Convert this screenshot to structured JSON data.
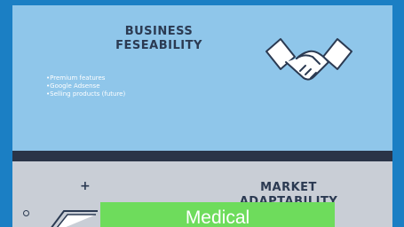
{
  "business": {
    "title_line1": "BUSINESS",
    "title_line2": "FESEABILITY",
    "bullets": [
      "Premium features",
      "Google Adsense",
      "Selling products (future)"
    ]
  },
  "market": {
    "title": "MARKET ADAPTABILITY"
  },
  "badge": {
    "label": "Medical"
  },
  "icons": {
    "handshake": "handshake-icon",
    "plus": "plus-icon",
    "circle": "circle-icon",
    "device": "device-icon"
  },
  "colors": {
    "outer_background": "#1b7fc4",
    "top_panel": "#8fc6ea",
    "divider": "#2a3447",
    "bottom_panel": "#c9ced6",
    "badge": "#6edc5c",
    "heading_text": "#2b3a52"
  }
}
